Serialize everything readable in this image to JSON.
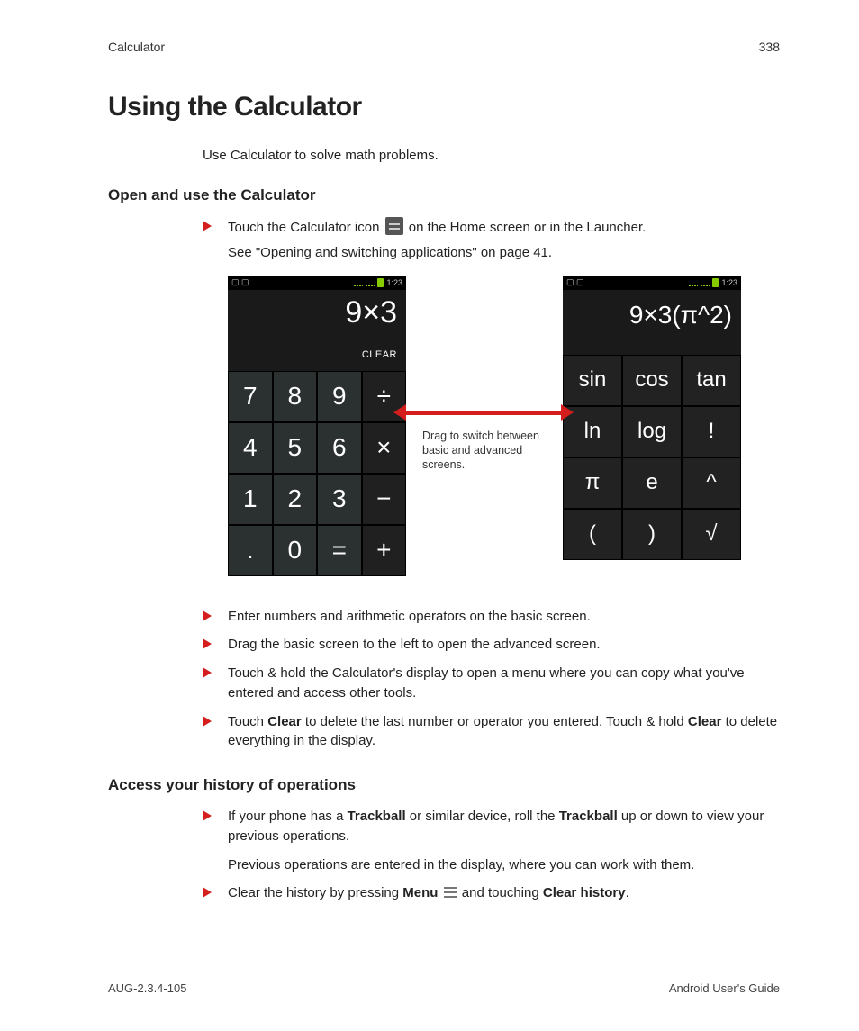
{
  "header": {
    "left": "Calculator",
    "right": "338"
  },
  "title": "Using the Calculator",
  "intro": "Use Calculator to solve math problems.",
  "section1": {
    "heading": "Open and use the Calculator",
    "bullet1_a": "Touch the Calculator icon ",
    "bullet1_b": " on the Home screen or in the Launcher.",
    "bullet1_sub": "See \"Opening and switching applications\" on page 41.",
    "bullet2": "Enter numbers and arithmetic operators on the basic screen.",
    "bullet3": "Drag the basic screen to the left to open the advanced screen.",
    "bullet4": "Touch & hold the Calculator's display to open a menu where you can copy what you've entered and access other tools.",
    "bullet5_a": "Touch ",
    "bullet5_clear": "Clear",
    "bullet5_b": " to delete the last number or operator you entered. Touch & hold ",
    "bullet5_c": " to delete everything in the display."
  },
  "phones": {
    "time": "1:23",
    "basic_display": "9×3",
    "adv_display": "9×3(π^2)",
    "clear_label": "CLEAR",
    "basic_keys": [
      "7",
      "8",
      "9",
      "÷",
      "4",
      "5",
      "6",
      "×",
      "1",
      "2",
      "3",
      "−",
      ".",
      "0",
      "=",
      "+"
    ],
    "basic_ops_idx": [
      3,
      7,
      11,
      15
    ],
    "adv_keys": [
      "sin",
      "cos",
      "tan",
      "ln",
      "log",
      "!",
      "π",
      "e",
      "^",
      "(",
      ")",
      "√"
    ],
    "annotation": "Drag to switch between basic and advanced screens."
  },
  "section2": {
    "heading": "Access your history of operations",
    "bullet1_a": "If your phone has a ",
    "bullet1_track": "Trackball",
    "bullet1_b": " or similar device, roll the ",
    "bullet1_c": " up or down to view your previous operations.",
    "bullet1_sub": "Previous operations are entered in the display, where you can work with them.",
    "bullet2_a": "Clear the history by pressing ",
    "bullet2_menu": "Menu",
    "bullet2_b": " and touching ",
    "bullet2_ch": "Clear history",
    "bullet2_c": "."
  },
  "footer": {
    "left": "AUG-2.3.4-105",
    "right": "Android User's Guide"
  }
}
